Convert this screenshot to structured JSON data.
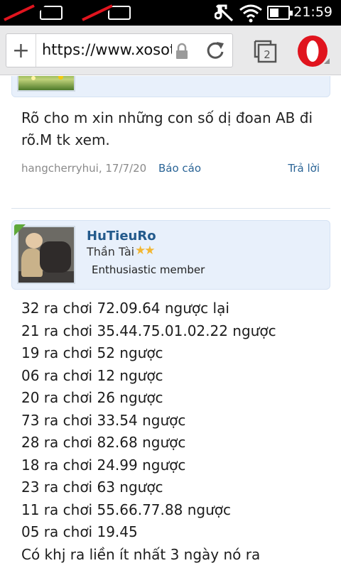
{
  "status_bar": {
    "time": "21:59",
    "icons": [
      "sim1-no-signal-icon",
      "sim2-no-signal-icon",
      "mute-icon",
      "wifi-icon",
      "battery-icon"
    ]
  },
  "browser": {
    "url": "https://www.xosot",
    "tab_count": "2",
    "icons": [
      "new-tab-plus-icon",
      "lock-icon",
      "reload-icon",
      "tabs-icon",
      "opera-logo"
    ]
  },
  "post1": {
    "message": "Rõ cho m xin những con số dị đoan AB đi rõ.M tk xem.",
    "author_date": "hangcherryhui, 17/7/20",
    "report": "Báo cáo",
    "reply": "Trả lời"
  },
  "post2": {
    "username": "HuTieuRo",
    "rank": "Thần Tài",
    "stars": "★★",
    "status": "Enthusiastic member",
    "lines": [
      "32 ra chơi 72.09.64 ngược lại",
      "21 ra chơi 35.44.75.01.02.22 ngược",
      "19 ra chơi 52 ngược",
      "06 ra chơi 12 ngược",
      "20 ra chơi 26 ngược",
      "73 ra chơi 33.54 ngược",
      "28 ra chơi 82.68 ngược",
      "18 ra chơi 24.99 ngược",
      "23 ra chơi 63 ngược",
      "11 ra chơi 55.66.77.88 ngược",
      "05 ra chơi 19.45",
      "Có khj ra liền ít nhất 3 ngày nó ra"
    ]
  },
  "colors": {
    "status_bar": "#000000",
    "toolbar": "#e9e9ea",
    "user_box": "#e8f0fb",
    "link": "#2a6496",
    "username": "#235a8c",
    "opera_red": "#e0141e"
  }
}
